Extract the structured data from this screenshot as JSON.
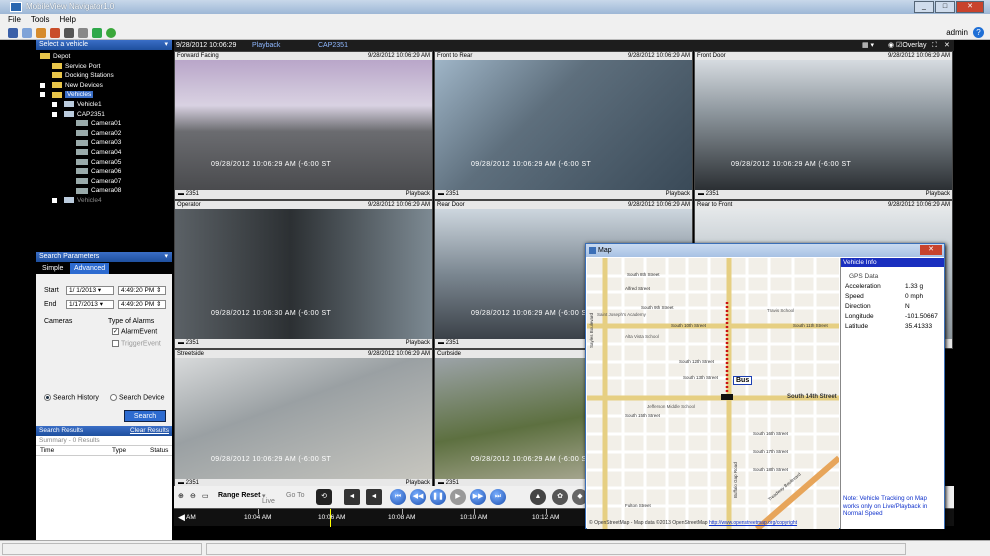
{
  "window": {
    "title": "MobileView Navigator1.0"
  },
  "menu": [
    "File",
    "Tools",
    "Help"
  ],
  "toolbar": {
    "user": "admin",
    "help": "?"
  },
  "vehicle_panel": {
    "header": "Select a vehicle",
    "tree": [
      {
        "label": "Depot",
        "level": 0,
        "icon": "folder-icon"
      },
      {
        "label": "Service Port",
        "level": 1,
        "icon": "folder-icon"
      },
      {
        "label": "Docking Stations",
        "level": 1,
        "icon": "folder-icon"
      },
      {
        "label": "New Devices",
        "level": 1,
        "icon": "folder-icon"
      },
      {
        "label": "Vehicles",
        "level": 1,
        "icon": "folder-icon",
        "selected": true
      },
      {
        "label": "Vehicle1",
        "level": 2,
        "icon": "bus-icon"
      },
      {
        "label": "CAP2351",
        "level": 2,
        "icon": "bus-icon"
      },
      {
        "label": "Camera01",
        "level": 3,
        "icon": "camera-icon"
      },
      {
        "label": "Camera02",
        "level": 3,
        "icon": "camera-icon"
      },
      {
        "label": "Camera03",
        "level": 3,
        "icon": "camera-icon"
      },
      {
        "label": "Camera04",
        "level": 3,
        "icon": "camera-icon"
      },
      {
        "label": "Camera05",
        "level": 3,
        "icon": "camera-icon"
      },
      {
        "label": "Camera06",
        "level": 3,
        "icon": "camera-icon"
      },
      {
        "label": "Camera07",
        "level": 3,
        "icon": "camera-icon"
      },
      {
        "label": "Camera08",
        "level": 3,
        "icon": "camera-icon"
      },
      {
        "label": "Vehicle4",
        "level": 2,
        "icon": "bus-icon"
      }
    ]
  },
  "search": {
    "header": "Search Parameters",
    "tabs": [
      "Simple",
      "Advanced"
    ],
    "start_label": "Start",
    "start_date": "1/ 1/2013",
    "start_time": "4:49:20 PM",
    "end_label": "End",
    "end_date": "1/17/2013",
    "end_time": "4:49:20 PM",
    "cameras_label": "Cameras",
    "alarms_label": "Type of Alarms",
    "alarm_event": "AlarmEvent",
    "trigger_event": "TriggerEvent",
    "search_history": "Search History",
    "search_device": "Search Device",
    "search_button": "Search"
  },
  "results": {
    "header": "Search Results",
    "clear": "Clear Results",
    "summary": "Summary - 0 Results",
    "cols": [
      "Time",
      "Type",
      "Status"
    ]
  },
  "main_header": {
    "datetime": "9/28/2012 10:06:29",
    "mode": "Playback",
    "vehicle": "CAP2351",
    "overlay": "Overlay"
  },
  "cameras": [
    {
      "name": "Forward Facing",
      "time": "9/28/2012 10:06:29 AM",
      "osd": "09/28/2012 10:06:29 AM (-6:00 ST",
      "id": "2351",
      "mode": "Playback"
    },
    {
      "name": "Front to Rear",
      "time": "9/28/2012 10:06:29 AM",
      "osd": "09/28/2012 10:06:29 AM (-6:00 ST",
      "id": "2351",
      "mode": "Playback"
    },
    {
      "name": "Front Door",
      "time": "9/28/2012 10:06:29 AM",
      "osd": "09/28/2012 10:06:29 AM (-6:00 ST",
      "id": "2351",
      "mode": "Playback"
    },
    {
      "name": "Operator",
      "time": "9/28/2012 10:06:29 AM",
      "osd": "09/28/2012 10:06:30 AM (-6:00 ST",
      "id": "2351",
      "mode": "Playback"
    },
    {
      "name": "Rear Door",
      "time": "9/28/2012 10:06:29 AM",
      "osd": "09/28/2012 10:06:29 AM (-6:00 ST",
      "id": "2351",
      "mode": "Playback"
    },
    {
      "name": "Rear to Front",
      "time": "9/28/2012 10:06:29 AM",
      "osd": "",
      "id": "",
      "mode": ""
    },
    {
      "name": "Streetside",
      "time": "9/28/2012 10:06:29 AM",
      "osd": "09/28/2012 10:06:29 AM (-6:00 ST",
      "id": "2351",
      "mode": "Playback"
    },
    {
      "name": "Curbside",
      "time": "9/28/2012 10:06:29 AM",
      "osd": "09/28/2012 10:06:29 AM (-6:00 ST",
      "id": "2351",
      "mode": "Playback"
    }
  ],
  "controls": {
    "range_reset": "Range Reset",
    "live": "Live",
    "goto": "Go To"
  },
  "timeline": [
    "AM",
    "10:04 AM",
    "10:06 AM",
    "10:08 AM",
    "10:10 AM",
    "10:12 AM"
  ],
  "map": {
    "title": "Map",
    "bus_label": "Bus",
    "copyright": "© OpenStreetMap - Map data ©2013 OpenStreetMap",
    "link": "http://www.openstreetmap.org/copyright",
    "streets": [
      "South 8th Street",
      "Alfred Street",
      "South 9th Street",
      "South 10th Street",
      "South 11th Street",
      "South 12th Street",
      "South 13th Street",
      "South 14th Street",
      "South 15th Street",
      "South 16th Street",
      "South 17th Street",
      "South 18th Street",
      "Fulton Street",
      "Sayles Boulevard",
      "Buffalo Gap Road",
      "Treadway Boulevard",
      "Jefferson Middle School",
      "Alta Vista School",
      "Saint Joseph's Academy",
      "Travis School"
    ]
  },
  "vehicle_info": {
    "header": "Vehicle Info",
    "gps_title": "GPS Data",
    "rows": [
      {
        "k": "Acceleration",
        "v": "1.33 g"
      },
      {
        "k": "Speed",
        "v": "0 mph"
      },
      {
        "k": "Direction",
        "v": "N"
      },
      {
        "k": "Longitude",
        "v": "-101.50667"
      },
      {
        "k": "Latitude",
        "v": "35.41333"
      }
    ],
    "note": "Note: Vehicle Tracking on Map works only on Live/Playback in Normal Speed"
  }
}
